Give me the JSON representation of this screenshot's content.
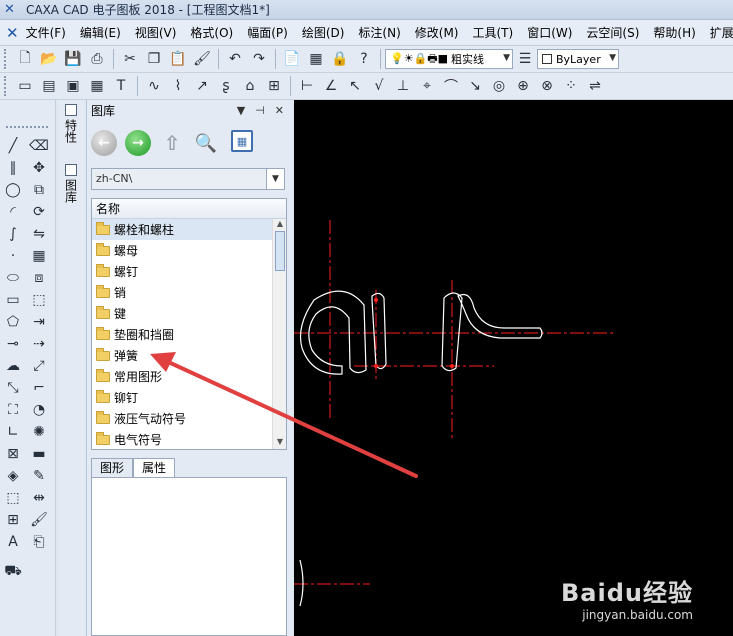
{
  "window": {
    "title": "CAXA CAD 电子图板 2018 - [工程图文档1*]"
  },
  "menu": [
    "文件(F)",
    "编辑(E)",
    "视图(V)",
    "格式(O)",
    "幅面(P)",
    "绘图(D)",
    "标注(N)",
    "修改(M)",
    "工具(T)",
    "窗口(W)",
    "云空间(S)",
    "帮助(H)",
    "扩展"
  ],
  "toolbar": {
    "linetype_value": "粗实线",
    "color_value": "ByLayer"
  },
  "library": {
    "title": "图库",
    "path_value": "zh-CN\\",
    "column_header": "名称",
    "items": [
      "螺栓和螺柱",
      "螺母",
      "螺钉",
      "销",
      "键",
      "垫圈和挡圈",
      "弹簧",
      "常用图形",
      "铆钉",
      "液压气动符号",
      "电气符号"
    ],
    "selected_item": "螺栓和螺柱",
    "tabs": [
      "图形",
      "属性"
    ],
    "active_tab": "属性"
  },
  "side_tabs": [
    "特性",
    "图库"
  ],
  "watermark": {
    "logo": "Baidu经验",
    "url": "jingyan.baidu.com"
  },
  "colors": {
    "canvas_bg": "#000000",
    "accent_line": "#ff2020",
    "arrow": "#e04040"
  }
}
